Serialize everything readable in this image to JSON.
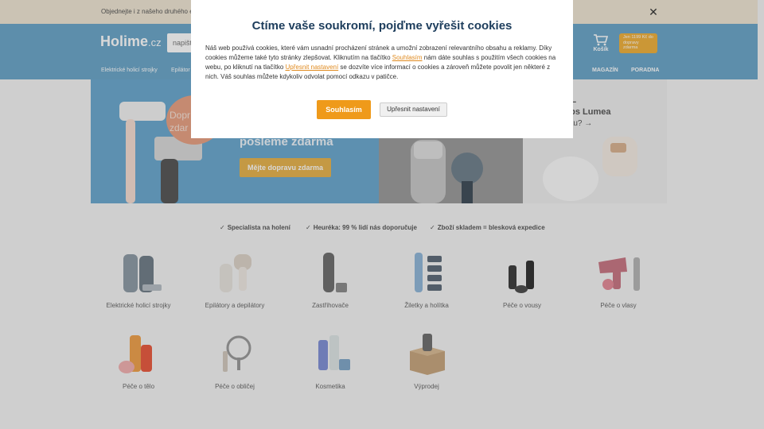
{
  "topbar": {
    "text": "Objednejte i z našeho druhého e-sho",
    "close_icon": "close-icon"
  },
  "header": {
    "logo_main": "Holime",
    "logo_tld": ".cz",
    "search_placeholder": "napišt",
    "cart_label": "Košík",
    "shipping_badge": "Jen 1199 Kč do dopravy zdarma",
    "nav": {
      "item1": "Elektrické holicí strojky",
      "item2": "Epilátor",
      "magazin": "MAGAZÍN",
      "poradna": "PORADNA"
    }
  },
  "banners": {
    "b1_badge": [
      "Dopr",
      "zdar"
    ],
    "b1_title": "pošleme zdarma",
    "b1_button": "Mějte dopravu zdarma",
    "b3_lines": [
      "IPL",
      "ilips Lumea",
      "estu? →"
    ]
  },
  "perks": [
    "Specialista na holení",
    "Heuréka: 99 % lidí nás doporučuje",
    "Zboží skladem = blesková expedice"
  ],
  "categories": [
    "Elektrické holicí strojky",
    "Epilátory a depilátory",
    "Zastřihovače",
    "Žiletky a holítka",
    "Péče o vousy",
    "Péče o vlasy",
    "Péče o tělo",
    "Péče o obličej",
    "Kosmetika",
    "Výprodej"
  ],
  "modal": {
    "title": "Ctíme vaše soukromí, pojďme vyřešit cookies",
    "text_1": "Náš web používá cookies, které vám usnadní procházení stránek a umožní zobrazení relevantního obsahu a reklamy. Díky cookies můžeme také tyto stránky zlepšovat. Kliknutím na tlačítko ",
    "link_1": "Souhlasím",
    "text_2": " nám dáte souhlas s použitím všech cookies na webu, po kliknutí na tlačítko ",
    "link_2": "Upřesnit nastavení",
    "text_3": " se dozvíte více informací o cookies a zároveň můžete povolit jen některé z nich. Váš souhlas můžete kdykoliv odvolat pomocí odkazu v patičce.",
    "accept": "Souhlasím",
    "settings": "Upřesnit nastavení"
  },
  "colors": {
    "header": "#6aa5c9",
    "accent": "#ef9a1a",
    "title": "#1d3d5c"
  }
}
